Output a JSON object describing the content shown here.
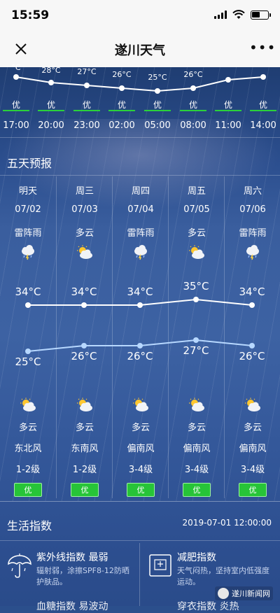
{
  "status_bar": {
    "time": "15:59"
  },
  "nav": {
    "title": "遂川天气"
  },
  "hourly": {
    "partial_first_temp": "°C",
    "temps": [
      "28°C",
      "27°C",
      "26°C",
      "25°C",
      "26°C"
    ],
    "temp_values": [
      30,
      28,
      27,
      26,
      25,
      26,
      29,
      30
    ],
    "aqi": [
      "优",
      "优",
      "优",
      "优",
      "优",
      "优",
      "优",
      "优"
    ],
    "times": [
      "17:00",
      "20:00",
      "23:00",
      "02:00",
      "05:00",
      "08:00",
      "11:00",
      "14:00"
    ]
  },
  "five_day": {
    "title": "五天预报",
    "days": [
      {
        "name": "明天",
        "date": "07/02",
        "weather_day": "雷阵雨",
        "icon_day": "thunderstorm-icon",
        "high": "34°C",
        "low": "25°C",
        "weather_night": "多云",
        "icon_night": "partly-cloudy-icon",
        "wind": "东北风",
        "level": "1-2级",
        "aqi": "优"
      },
      {
        "name": "周三",
        "date": "07/03",
        "weather_day": "多云",
        "icon_day": "partly-cloudy-icon",
        "high": "34°C",
        "low": "26°C",
        "weather_night": "多云",
        "icon_night": "partly-cloudy-icon",
        "wind": "东南风",
        "level": "1-2级",
        "aqi": "优"
      },
      {
        "name": "周四",
        "date": "07/04",
        "weather_day": "雷阵雨",
        "icon_day": "thunderstorm-icon",
        "high": "34°C",
        "low": "26°C",
        "weather_night": "多云",
        "icon_night": "partly-cloudy-icon",
        "wind": "偏南风",
        "level": "3-4级",
        "aqi": "优"
      },
      {
        "name": "周五",
        "date": "07/05",
        "weather_day": "多云",
        "icon_day": "partly-cloudy-icon",
        "high": "35°C",
        "low": "27°C",
        "weather_night": "多云",
        "icon_night": "partly-cloudy-icon",
        "wind": "偏南风",
        "level": "3-4级",
        "aqi": "优"
      },
      {
        "name": "周六",
        "date": "07/06",
        "weather_day": "雷阵雨",
        "icon_day": "thunderstorm-icon",
        "high": "34°C",
        "low": "26°C",
        "weather_night": "多云",
        "icon_night": "partly-cloudy-icon",
        "wind": "偏南风",
        "level": "3-4级",
        "aqi": "优"
      }
    ],
    "highs": [
      34,
      34,
      34,
      35,
      34
    ],
    "lows": [
      25,
      26,
      26,
      27,
      26
    ]
  },
  "life": {
    "title": "生活指数",
    "datetime": "2019-07-01 12:00:00",
    "cards": [
      {
        "name": "紫外线指数 最弱",
        "desc": "辐射弱，涂擦SPF8-12防晒护肤品。",
        "icon": "umbrella-icon"
      },
      {
        "name": "减肥指数",
        "desc": "天气闷热，坚持室内低强度运动。",
        "icon": "scale-icon"
      }
    ],
    "bottom_cut": [
      "血糖指数 易波动",
      "穿衣指数 炎热"
    ]
  },
  "watermark": {
    "text": "遂川新闻网"
  }
}
